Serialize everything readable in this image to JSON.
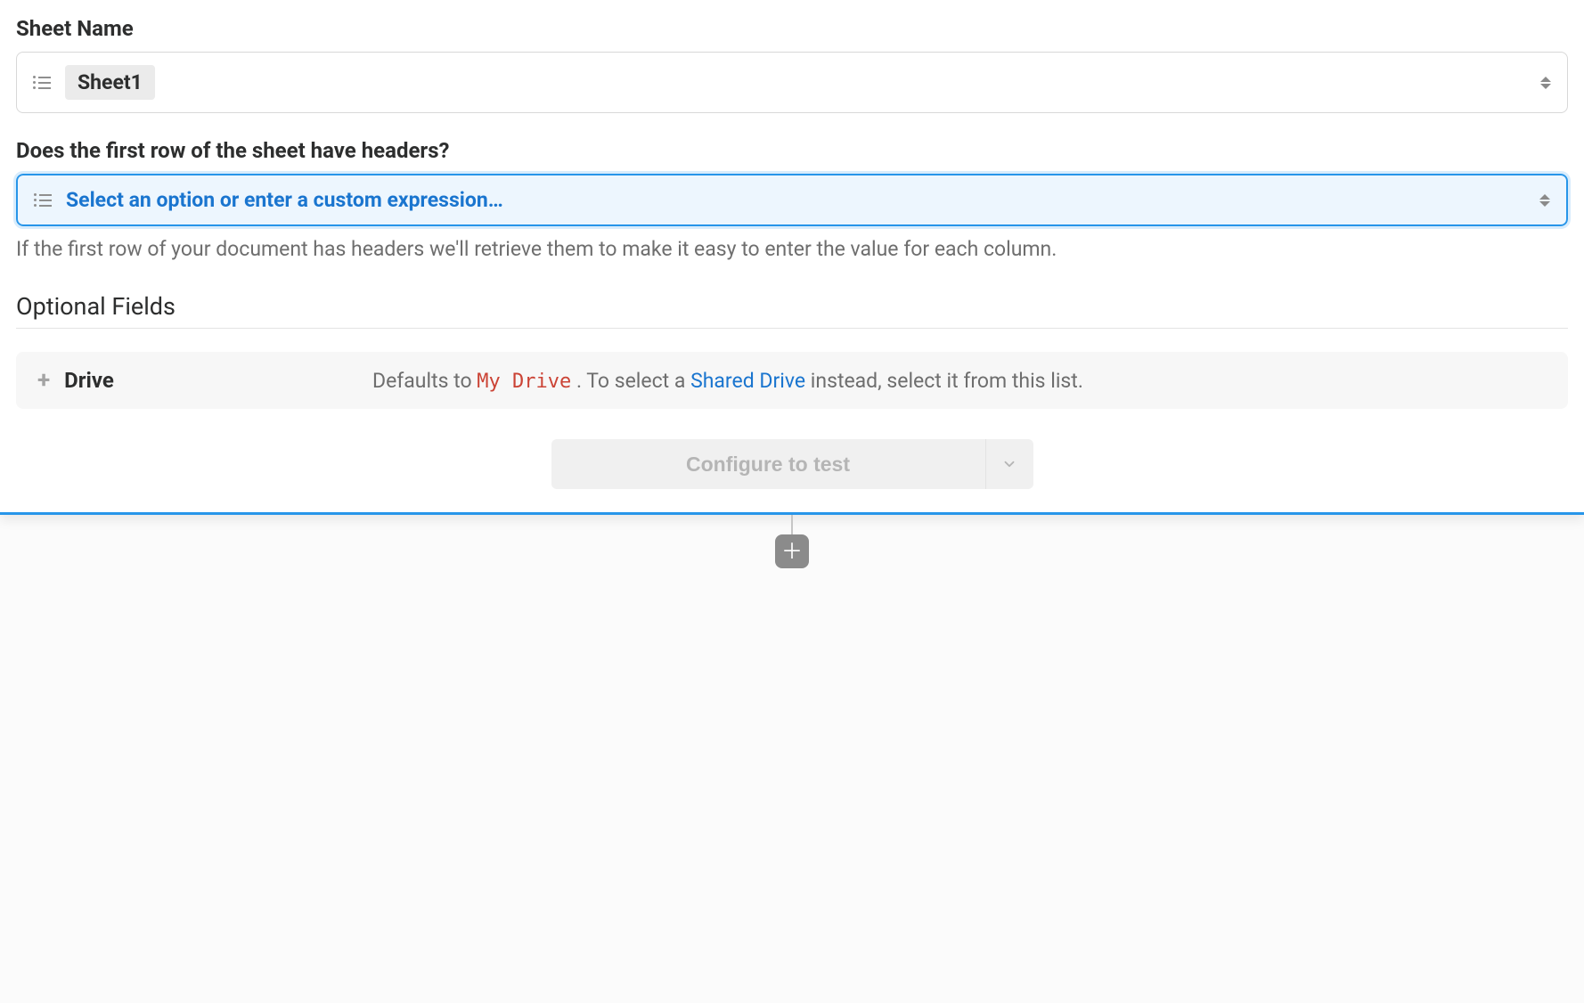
{
  "fields": {
    "sheetName": {
      "label": "Sheet Name",
      "value": "Sheet1"
    },
    "headersQuestion": {
      "label": "Does the first row of the sheet have headers?",
      "placeholder": "Select an option or enter a custom expression…",
      "helper": "If the first row of your document has headers we'll retrieve them to make it easy to enter the value for each column."
    }
  },
  "optional": {
    "heading": "Optional Fields",
    "drive": {
      "label": "Drive",
      "desc_prefix": "Defaults to ",
      "desc_code": "My Drive",
      "desc_mid": " . To select a ",
      "desc_link": "Shared Drive",
      "desc_suffix": " instead, select it from this list."
    }
  },
  "actions": {
    "configure": "Configure to test"
  }
}
